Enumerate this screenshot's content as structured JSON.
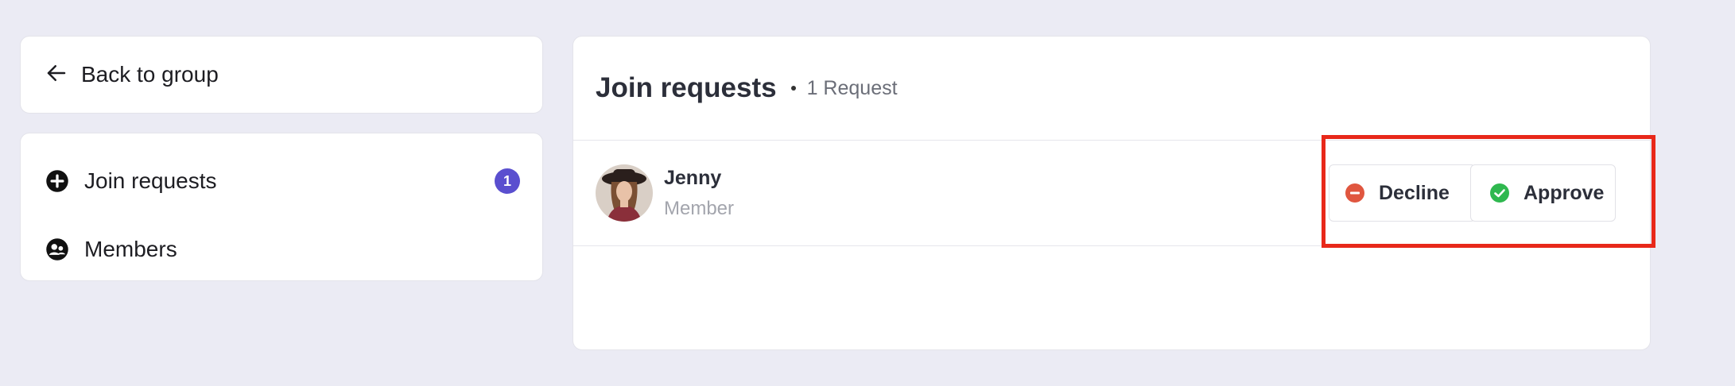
{
  "sidebar": {
    "back_label": "Back to group",
    "items": [
      {
        "label": "Join requests",
        "icon": "plus-circle-icon",
        "badge": "1"
      },
      {
        "label": "Members",
        "icon": "members-icon"
      }
    ]
  },
  "main": {
    "title": "Join requests",
    "request_count": "1 Request",
    "requests": [
      {
        "name": "Jenny",
        "role": "Member"
      }
    ],
    "actions": {
      "decline_label": "Decline",
      "approve_label": "Approve"
    }
  },
  "colors": {
    "background": "#ebebf4",
    "badge": "#5a4fcf",
    "decline": "#e0563f",
    "approve": "#2fb84f",
    "highlight": "#e8281a"
  }
}
